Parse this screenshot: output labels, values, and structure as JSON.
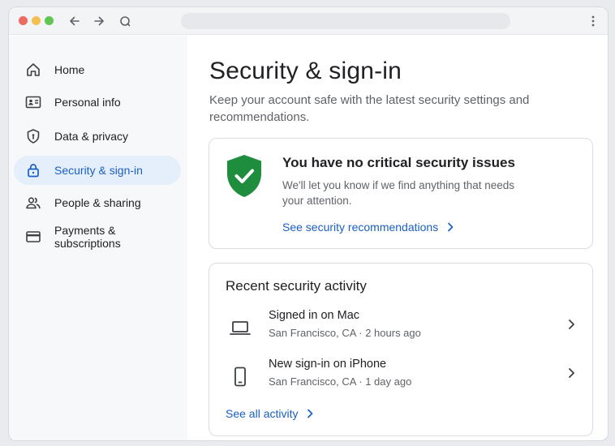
{
  "sidebar": {
    "items": [
      {
        "label": "Home",
        "icon": "home-icon"
      },
      {
        "label": "Personal info",
        "icon": "id-card-icon"
      },
      {
        "label": "Data & privacy",
        "icon": "shield-outline-icon"
      },
      {
        "label": "Security & sign-in",
        "icon": "lock-icon",
        "active": true
      },
      {
        "label": "People & sharing",
        "icon": "people-icon"
      },
      {
        "label": "Payments & subscriptions",
        "icon": "credit-card-icon"
      }
    ]
  },
  "main": {
    "title": "Security & sign-in",
    "subtitle": "Keep your account safe with the latest security settings and recommendations."
  },
  "status_card": {
    "title": "You have no critical security issues",
    "text": "We'll let you know if we find anything that needs your attention.",
    "link": "See security recommendations"
  },
  "activity": {
    "title": "Recent security activity",
    "items": [
      {
        "title": "Signed in on Mac",
        "detail": "San Francisco, CA · 2 hours ago",
        "icon": "laptop-icon"
      },
      {
        "title": "New sign-in on iPhone",
        "detail": "San Francisco, CA · 1 day ago",
        "icon": "phone-icon"
      }
    ],
    "link": "See all activity"
  },
  "colors": {
    "accent": "#1a5fc2",
    "active_bg": "#e5effc",
    "shield_green": "#1e8e3e",
    "traffic_red": "#ed6a5e",
    "traffic_yellow": "#f5bf4f",
    "traffic_green": "#61c554"
  }
}
